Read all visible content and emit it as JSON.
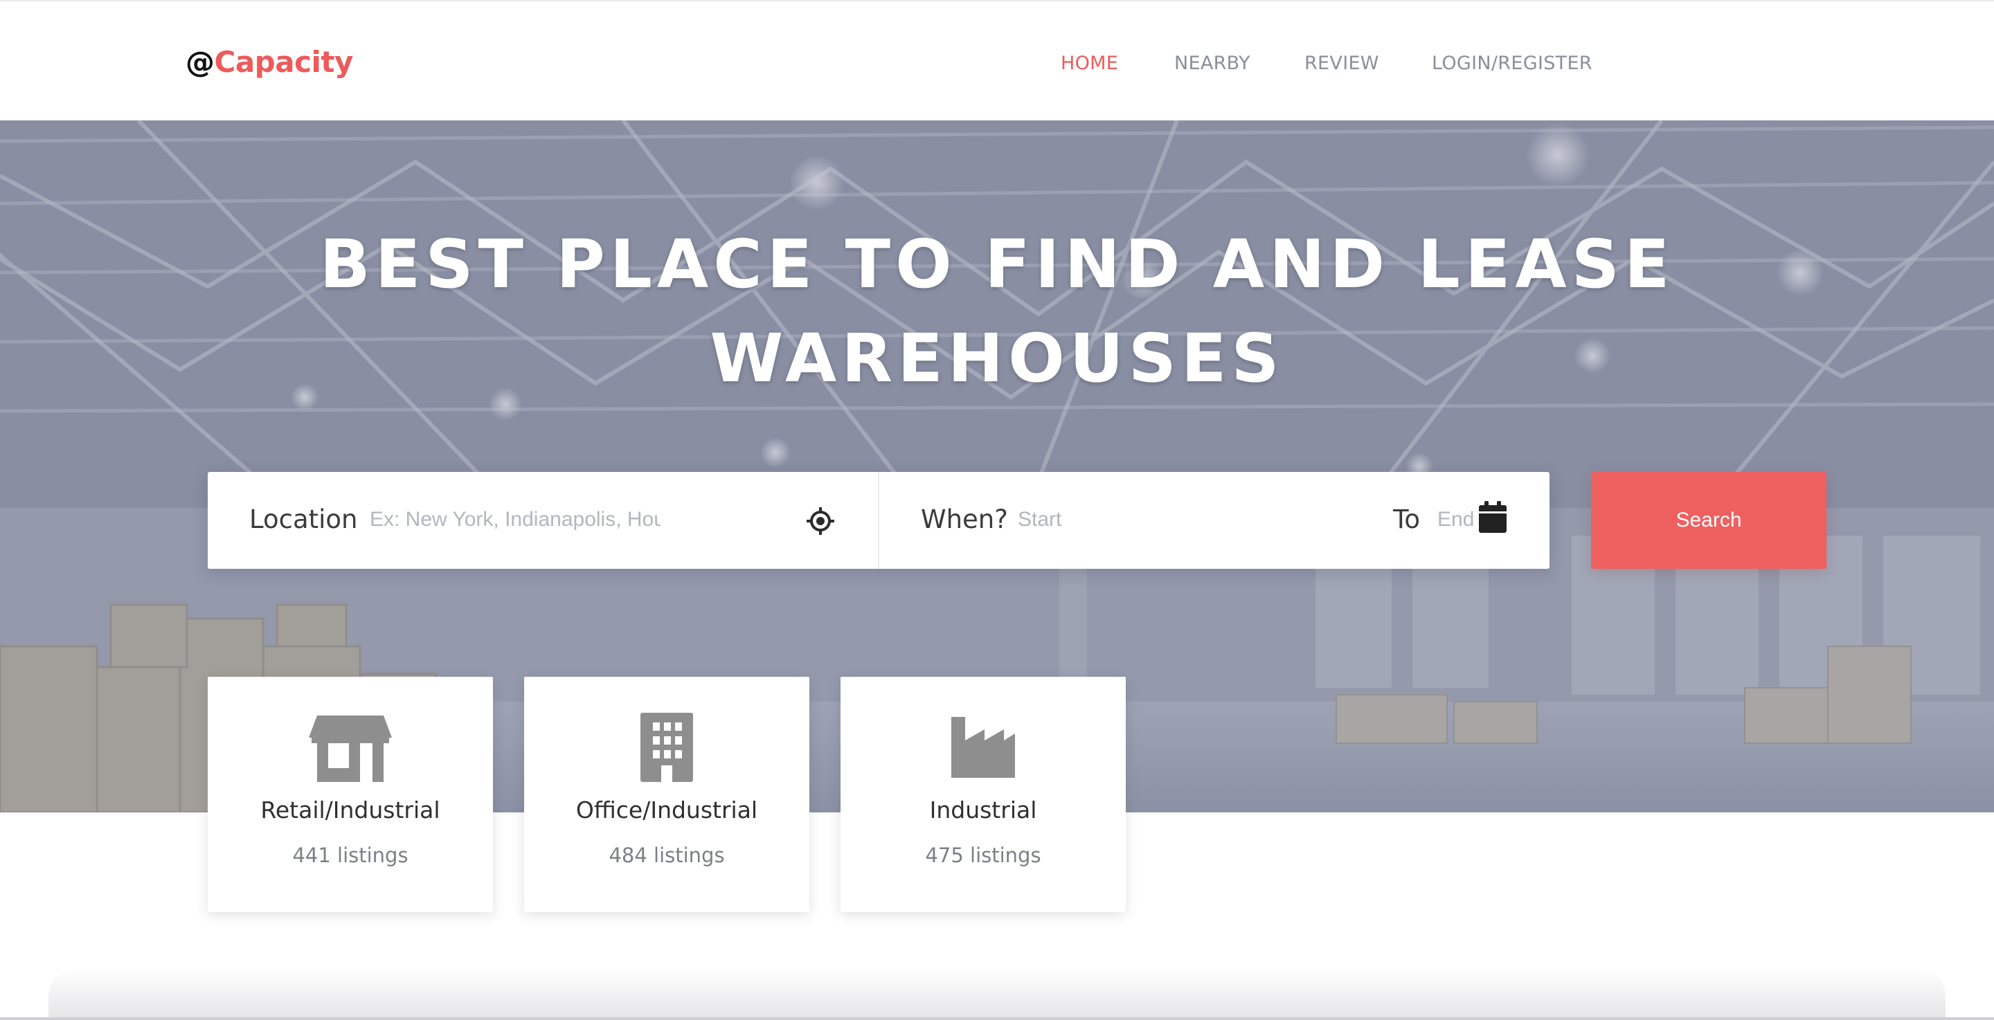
{
  "brand": {
    "at": "@",
    "name": "Capacity"
  },
  "nav": {
    "items": [
      {
        "label": "HOME",
        "active": true
      },
      {
        "label": "NEARBY",
        "active": false
      },
      {
        "label": "REVIEW",
        "active": false
      },
      {
        "label": "LOGIN/REGISTER",
        "active": false
      }
    ]
  },
  "hero": {
    "title_line1": "BEST PLACE TO FIND AND LEASE",
    "title_line2": "WAREHOUSES"
  },
  "search": {
    "location_label": "Location",
    "location_placeholder": "Ex: New York, Indianapolis, Houston",
    "when_label": "When?",
    "start_placeholder": "Start",
    "to_label": "To",
    "end_placeholder": "End",
    "button_label": "Search"
  },
  "categories": [
    {
      "title": "Retail/Industrial",
      "count": "441 listings",
      "icon": "store-icon"
    },
    {
      "title": "Office/Industrial",
      "count": "484 listings",
      "icon": "building-icon"
    },
    {
      "title": "Industrial",
      "count": "475 listings",
      "icon": "industry-icon"
    }
  ],
  "colors": {
    "accent": "#ee5a5a",
    "nav_text": "#8a8f98",
    "icon_gray": "#8e8e8e",
    "button": "#ee6060"
  }
}
